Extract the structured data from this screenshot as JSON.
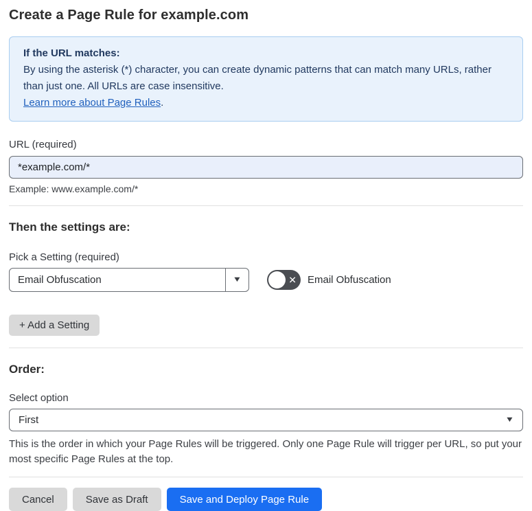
{
  "page": {
    "title": "Create a Page Rule for example.com"
  },
  "info_box": {
    "heading": "If the URL matches:",
    "body": "By using the asterisk (*) character, you can create dynamic patterns that can match many URLs, rather than just one. All URLs are case insensitive.",
    "link_label": "Learn more about Page Rules",
    "link_suffix": "."
  },
  "url_field": {
    "label": "URL (required)",
    "value": "*example.com/*",
    "helper": "Example: www.example.com/*"
  },
  "settings_section": {
    "heading": "Then the settings are:",
    "picker_label": "Pick a Setting (required)",
    "picker_value": "Email Obfuscation",
    "toggle_label": "Email Obfuscation",
    "toggle_state": "off",
    "add_setting_button": "+ Add a Setting"
  },
  "order_section": {
    "heading": "Order:",
    "select_label": "Select option",
    "select_value": "First",
    "helper": "This is the order in which your Page Rules will be triggered. Only one Page Rule will trigger per URL, so put your most specific Page Rules at the top."
  },
  "footer": {
    "cancel_label": "Cancel",
    "save_draft_label": "Save as Draft",
    "save_deploy_label": "Save and Deploy Page Rule"
  },
  "icons": {
    "dropdown_arrow": "▼",
    "toggle_x": "✕"
  },
  "colors": {
    "accent_blue": "#1a6ef2",
    "info_box_bg": "#e9f2fc",
    "info_box_border": "#a9cdf0",
    "info_box_text": "#21395f",
    "link_blue": "#2161bd",
    "url_input_bg": "#e9effb",
    "field_border_gray": "#696d73",
    "toggle_off_gray": "#4a4d52",
    "button_gray": "#d9d9d9"
  }
}
